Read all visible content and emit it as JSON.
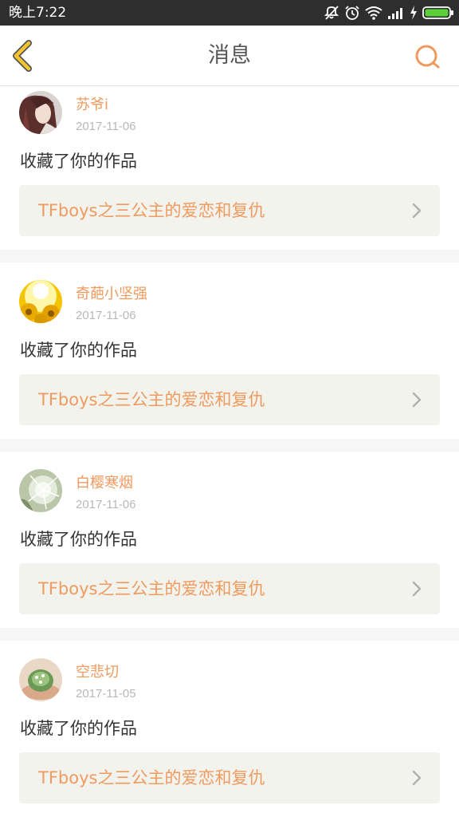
{
  "status_bar": {
    "time": "晚上7:22",
    "icons": [
      "mute-icon",
      "alarm-icon",
      "wifi-icon",
      "signal-icon",
      "charging-icon",
      "battery-icon"
    ]
  },
  "header": {
    "title": "消息",
    "back_icon": "chevron-left-icon",
    "search_icon": "search-icon"
  },
  "colors": {
    "accent": "#ef9a5e",
    "back_icon": "#f2c230",
    "link_background": "#f3f3ed",
    "separator": "#f6f6f6"
  },
  "notifications": [
    {
      "user": "苏爷i",
      "date": "2017-11-06",
      "action": "收藏了你的作品",
      "work_title": "TFboys之三公主的爱恋和复仇",
      "avatar": "anime-girl-avatar"
    },
    {
      "user": "奇葩小坚强",
      "date": "2017-11-06",
      "action": "收藏了你的作品",
      "work_title": "TFboys之三公主的爱恋和复仇",
      "avatar": "sunflower-avatar"
    },
    {
      "user": "白樱寒烟",
      "date": "2017-11-06",
      "action": "收藏了你的作品",
      "work_title": "TFboys之三公主的爱恋和复仇",
      "avatar": "dandelion-avatar"
    },
    {
      "user": "空悲切",
      "date": "2017-11-05",
      "action": "收藏了你的作品",
      "work_title": "TFboys之三公主的爱恋和复仇",
      "avatar": "plant-in-hands-avatar"
    }
  ]
}
